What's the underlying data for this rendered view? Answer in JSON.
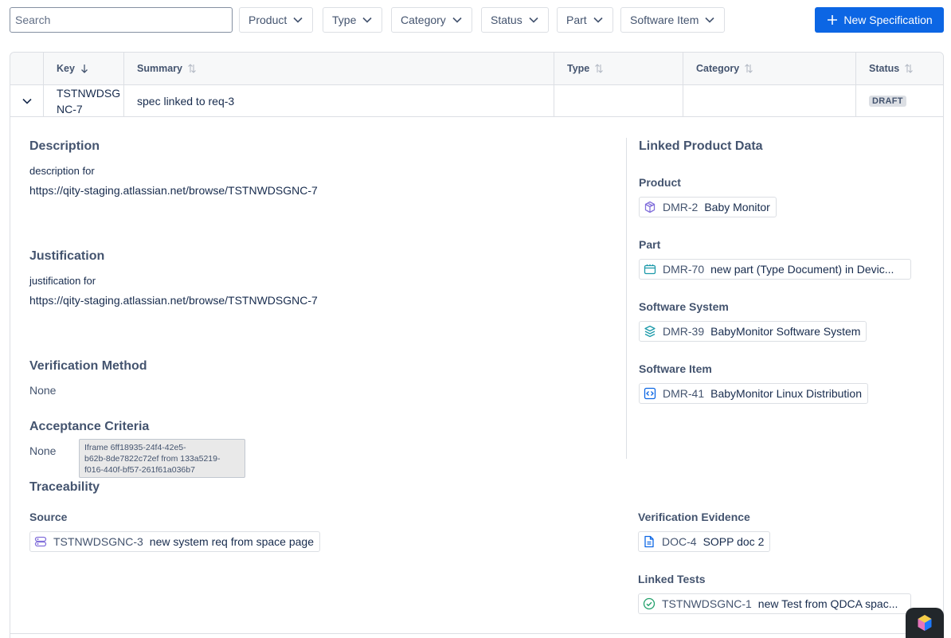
{
  "toolbar": {
    "search_placeholder": "Search",
    "filters": [
      "Product",
      "Type",
      "Category",
      "Status",
      "Part",
      "Software Item"
    ],
    "new_button": "New Specification"
  },
  "table": {
    "columns": [
      "Key",
      "Summary",
      "Type",
      "Category",
      "Status"
    ],
    "row": {
      "key": "TSTNWDSGNC-7",
      "key_line1": "TSTNWDSG",
      "key_line2": "NC-7",
      "summary": "spec linked to req-3",
      "type": "",
      "category": "",
      "status": "DRAFT"
    }
  },
  "detail": {
    "description": {
      "heading": "Description",
      "line1": "description for",
      "line2": "https://qity-staging.atlassian.net/browse/TSTNWDSGNC-7"
    },
    "justification": {
      "heading": "Justification",
      "line1": "justification for",
      "line2": "https://qity-staging.atlassian.net/browse/TSTNWDSGNC-7"
    },
    "verification_method": {
      "heading": "Verification Method",
      "value": "None"
    },
    "acceptance_criteria": {
      "heading": "Acceptance Criteria",
      "value": "None"
    },
    "tooltip": "Iframe 6ff18935-24f4-42e5-b62b-8de7822c72ef from 133a5219-f016-440f-bf57-261f61a036b7",
    "tooltip_l1": "Iframe 6ff18935-24f4-42e5-",
    "tooltip_l2": "b62b-8de7822c72ef from 133a5219-",
    "tooltip_l3": "f016-440f-bf57-261f61a036b7",
    "linked": {
      "heading": "Linked Product Data",
      "product": {
        "label": "Product",
        "key": "DMR-2",
        "name": "Baby Monitor",
        "icon": "box-icon"
      },
      "part": {
        "label": "Part",
        "key": "DMR-70",
        "name": "new part (Type Document) in Devic...",
        "icon": "part-icon"
      },
      "software_system": {
        "label": "Software System",
        "key": "DMR-39",
        "name": "BabyMonitor Software System",
        "icon": "layers-icon"
      },
      "software_item": {
        "label": "Software Item",
        "key": "DMR-41",
        "name": "BabyMonitor Linux Distribution",
        "icon": "code-icon"
      }
    },
    "traceability": {
      "heading": "Traceability",
      "source": {
        "label": "Source",
        "key": "TSTNWDSGNC-3",
        "name": "new system req from space page",
        "icon": "requirement-icon"
      },
      "verification_evidence": {
        "label": "Verification Evidence",
        "key": "DOC-4",
        "name": "SOPP doc 2",
        "icon": "document-icon"
      },
      "linked_tests": {
        "label": "Linked Tests",
        "key": "TSTNWDSGNC-1",
        "name": "new Test from QDCA spac...",
        "icon": "check-circle-icon"
      }
    }
  },
  "colors": {
    "primary": "#0c66e4",
    "text": "#172b4d",
    "muted": "#44546f",
    "border": "#dcdfe4"
  }
}
